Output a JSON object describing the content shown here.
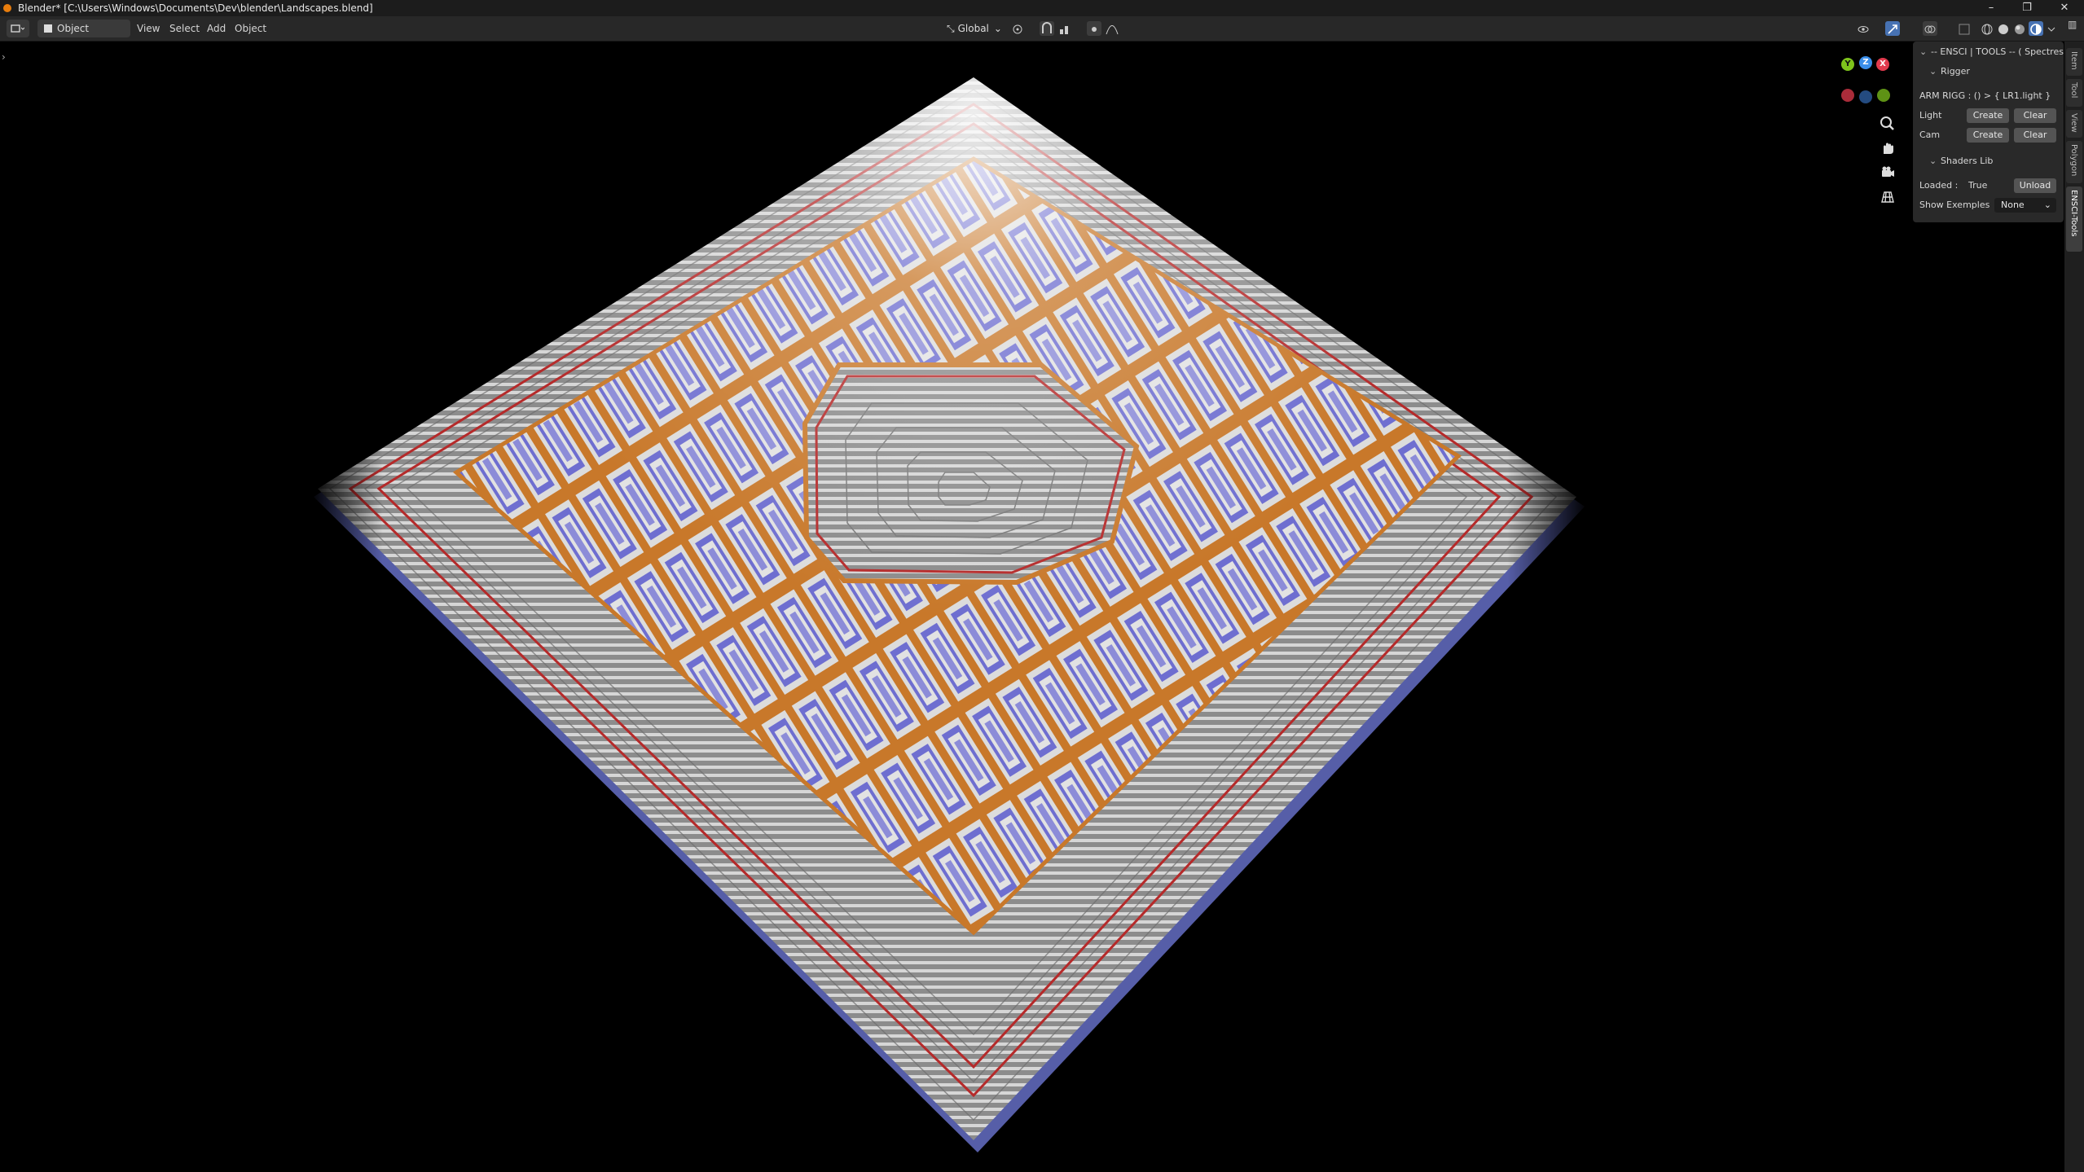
{
  "window": {
    "title": "Blender* [C:\\Users\\Windows\\Documents\\Dev\\blender\\Landscapes.blend]",
    "min_label": "–",
    "max_label": "❐",
    "close_label": "✕"
  },
  "header": {
    "mode": "Object Mode",
    "menus": [
      "View",
      "Select",
      "Add",
      "Object"
    ],
    "transform_orientation": "Global"
  },
  "gizmo": {
    "x_label": "X",
    "y_label": "Y",
    "z_label": "Z",
    "x_color": "#e23b4e",
    "y_color": "#7ec31c",
    "z_color": "#3a8ee9"
  },
  "panel": {
    "header": "-- ENSCI | TOOLS -- ( Spectres )",
    "rigger": {
      "title": "Rigger",
      "arm_label": "ARM RIGG : () > { LR1.light }",
      "light_label": "Light",
      "cam_label": "Cam",
      "create_label": "Create",
      "clear_label": "Clear"
    },
    "shaders": {
      "title": "Shaders Lib",
      "loaded_label": "Loaded :",
      "loaded_value": "True",
      "unload_label": "Unload",
      "examples_label": "Show Exemples",
      "examples_value": "None"
    }
  },
  "tabs": [
    "Item",
    "Tool",
    "View",
    "Polygon",
    "ENSCI-Tools"
  ],
  "colors": {
    "accent": "#4772b3",
    "plane_edge": "#565ea8",
    "pattern_orange": "#c8782a",
    "pattern_red": "#b52a2a",
    "pattern_blue": "#6e6ed0"
  }
}
